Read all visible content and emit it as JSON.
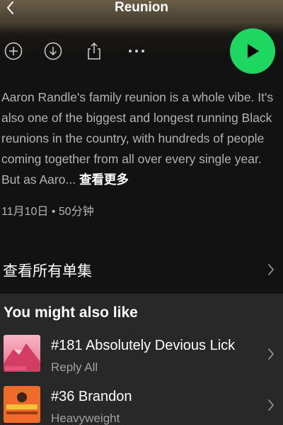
{
  "header": {
    "title": "Reunion"
  },
  "actions": {
    "add_icon": "plus-circle-icon",
    "download_icon": "download-circle-icon",
    "share_icon": "share-icon",
    "more_icon": "more-dots-icon",
    "play_icon": "play-icon"
  },
  "episode": {
    "description": "Aaron Randle's family reunion is a whole vibe. It's also one of the biggest and longest running Black reunions in the country, with hundreds of people coming together from all over every single year. But as Aaro...",
    "see_more": "查看更多",
    "meta": "11月10日 • 50分钟"
  },
  "all_episodes": {
    "label": "查看所有单集"
  },
  "recommendations": {
    "title": "You might also like",
    "items": [
      {
        "name": "#181 Absolutely Devious Lick",
        "show": "Reply All"
      },
      {
        "name": "#36 Brandon",
        "show": "Heavyweight"
      }
    ]
  },
  "colors": {
    "accent": "#1ed760",
    "background": "#121212",
    "panel": "#282828",
    "header_tint": "#6b5e47",
    "secondary_text": "#b3b3b3"
  }
}
